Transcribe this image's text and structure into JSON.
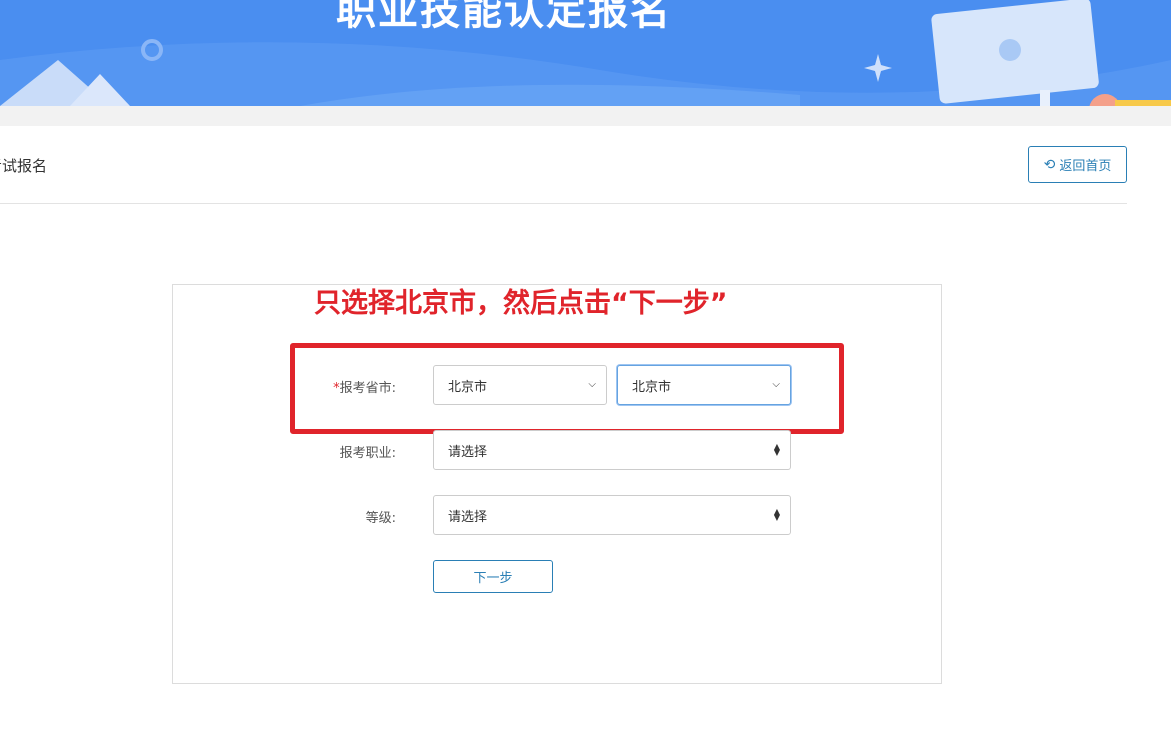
{
  "banner": {
    "title": "职业技能认定报名"
  },
  "page": {
    "title": "考试报名"
  },
  "back_button": {
    "label": "返回首页",
    "icon": "undo-arrow-icon"
  },
  "annotation": {
    "text": "只选择北京市，然后点击“下一步”"
  },
  "form": {
    "province_city": {
      "required_mark": "*",
      "label": "报考省市:",
      "province_value": "北京市",
      "city_value": "北京市"
    },
    "occupation": {
      "label": "报考职业:",
      "value": "请选择"
    },
    "level": {
      "label": "等级:",
      "value": "请选择"
    },
    "next_button": {
      "label": "下一步"
    }
  },
  "colors": {
    "banner_blue": "#4a8ef0",
    "link_blue": "#2a7fb5",
    "annotation_red": "#e0242b"
  }
}
